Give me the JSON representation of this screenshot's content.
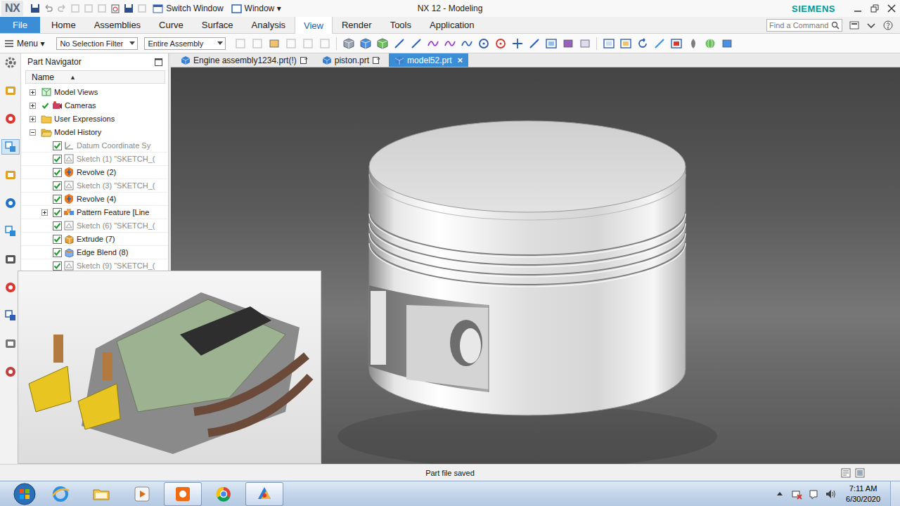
{
  "window": {
    "logo": "NX",
    "title": "NX 12 - Modeling",
    "brand": "SIEMENS"
  },
  "quick_access": {
    "switch_window": "Switch Window",
    "window_menu": "Window",
    "window_menu_arrow": "▾"
  },
  "ribbon": {
    "tabs": [
      {
        "label": "File",
        "kind": "file",
        "selected": false
      },
      {
        "label": "Home",
        "kind": "tab",
        "selected": false
      },
      {
        "label": "Assemblies",
        "kind": "tab",
        "selected": false
      },
      {
        "label": "Curve",
        "kind": "tab",
        "selected": false
      },
      {
        "label": "Surface",
        "kind": "tab",
        "selected": false
      },
      {
        "label": "Analysis",
        "kind": "tab",
        "selected": false
      },
      {
        "label": "View",
        "kind": "tab",
        "selected": true
      },
      {
        "label": "Render",
        "kind": "tab",
        "selected": false
      },
      {
        "label": "Tools",
        "kind": "tab",
        "selected": false
      },
      {
        "label": "Application",
        "kind": "tab",
        "selected": false
      }
    ],
    "search": {
      "placeholder": "Find a Command"
    }
  },
  "toolbar": {
    "menu": "Menu",
    "menu_arrow": "▾",
    "selection_filter": "No Selection Filter",
    "scope": "Entire Assembly"
  },
  "resource_bar": {
    "items": [
      {
        "selected": false
      },
      {
        "selected": false
      },
      {
        "selected": false
      },
      {
        "selected": true
      },
      {
        "selected": false
      },
      {
        "selected": false
      },
      {
        "selected": false
      },
      {
        "selected": false
      },
      {
        "selected": false
      },
      {
        "selected": false
      },
      {
        "selected": false
      },
      {
        "selected": false
      }
    ]
  },
  "part_navigator": {
    "title": "Part Navigator",
    "column": "Name",
    "sort_arrow": "▲",
    "items": [
      {
        "label": "Model Views",
        "kind": "views",
        "depth": 0,
        "expandable": true,
        "expanded": false,
        "checkbox": false,
        "checked": false,
        "dimmed": false
      },
      {
        "label": "Cameras",
        "kind": "camera",
        "depth": 0,
        "expandable": true,
        "expanded": false,
        "checkbox": false,
        "checked": true,
        "dimmed": false
      },
      {
        "label": "User Expressions",
        "kind": "folder",
        "depth": 0,
        "expandable": true,
        "expanded": false,
        "checkbox": false,
        "checked": false,
        "dimmed": false
      },
      {
        "label": "Model History",
        "kind": "folder-open",
        "depth": 0,
        "expandable": true,
        "expanded": true,
        "checkbox": false,
        "checked": false,
        "dimmed": false
      },
      {
        "label": "Datum Coordinate Sy",
        "kind": "datum",
        "depth": 1,
        "expandable": false,
        "expanded": false,
        "checkbox": true,
        "checked": true,
        "dimmed": true
      },
      {
        "label": "Sketch (1) \"SKETCH_(",
        "kind": "sketch",
        "depth": 1,
        "expandable": false,
        "expanded": false,
        "checkbox": true,
        "checked": true,
        "dimmed": true
      },
      {
        "label": "Revolve (2)",
        "kind": "revolve",
        "depth": 1,
        "expandable": false,
        "expanded": false,
        "checkbox": true,
        "checked": true,
        "dimmed": false
      },
      {
        "label": "Sketch (3) \"SKETCH_(",
        "kind": "sketch",
        "depth": 1,
        "expandable": false,
        "expanded": false,
        "checkbox": true,
        "checked": true,
        "dimmed": true
      },
      {
        "label": "Revolve (4)",
        "kind": "revolve",
        "depth": 1,
        "expandable": false,
        "expanded": false,
        "checkbox": true,
        "checked": true,
        "dimmed": false
      },
      {
        "label": "Pattern Feature [Line",
        "kind": "pattern",
        "depth": 1,
        "expandable": true,
        "expanded": false,
        "checkbox": true,
        "checked": true,
        "dimmed": false
      },
      {
        "label": "Sketch (6) \"SKETCH_(",
        "kind": "sketch",
        "depth": 1,
        "expandable": false,
        "expanded": false,
        "checkbox": true,
        "checked": true,
        "dimmed": true
      },
      {
        "label": "Extrude (7)",
        "kind": "extrude",
        "depth": 1,
        "expandable": false,
        "expanded": false,
        "checkbox": true,
        "checked": true,
        "dimmed": false
      },
      {
        "label": "Edge Blend (8)",
        "kind": "blend",
        "depth": 1,
        "expandable": false,
        "expanded": false,
        "checkbox": true,
        "checked": true,
        "dimmed": false
      },
      {
        "label": "Sketch (9) \"SKETCH_(",
        "kind": "sketch",
        "depth": 1,
        "expandable": false,
        "expanded": false,
        "checkbox": true,
        "checked": true,
        "dimmed": true
      }
    ]
  },
  "document_tabs": [
    {
      "label": "Engine assembly1234.prt(!)",
      "selected": false
    },
    {
      "label": "piston.prt",
      "selected": false
    },
    {
      "label": "model52.prt",
      "selected": true,
      "close": "×"
    }
  ],
  "status_bar": {
    "message": "Part file saved"
  },
  "taskbar": {
    "apps": [
      {
        "active": false
      },
      {
        "active": false
      },
      {
        "active": false
      },
      {
        "active": true
      },
      {
        "active": false
      },
      {
        "active": true
      }
    ],
    "time": "7:11 AM",
    "date": "6/30/2020"
  }
}
